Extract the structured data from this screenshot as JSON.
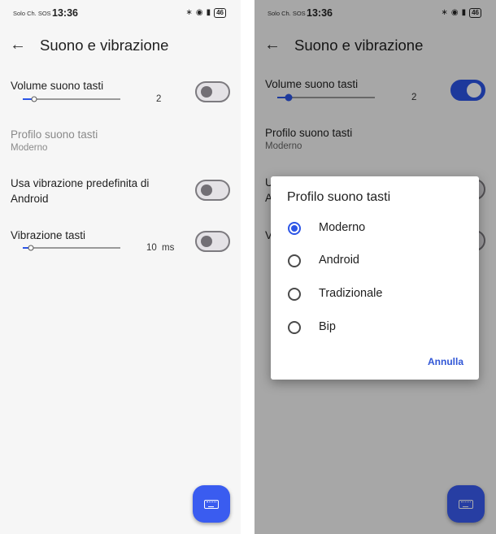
{
  "status_bar": {
    "carrier": "Solo Ch. SOS",
    "time": "13:36",
    "battery": "46",
    "icons": [
      "bluetooth-icon",
      "wifi-icon",
      "vibrate-icon",
      "battery-icon"
    ]
  },
  "appbar": {
    "back_icon": "back-arrow-icon",
    "title": "Suono e vibrazione"
  },
  "settings": {
    "volume": {
      "title": "Volume suono tasti",
      "value": "2",
      "level": 0.12
    },
    "profile": {
      "title": "Profilo suono tasti",
      "value": "Moderno"
    },
    "android_vibration": {
      "title": "Usa vibrazione predefinita di Android"
    },
    "key_vibration": {
      "title": "Vibrazione tasti",
      "value": "10",
      "unit": "ms",
      "level": 0.08
    }
  },
  "left_state": {
    "volume_toggle_on": false,
    "android_vibration_on": false,
    "key_vibration_on": false
  },
  "right_state": {
    "volume_toggle_on": true
  },
  "right_partial": {
    "android_vibration_fragment_line1": "U",
    "android_vibration_fragment_line2": "A",
    "key_vibration_fragment": "V"
  },
  "dialog": {
    "title": "Profilo suono tasti",
    "options": [
      {
        "label": "Moderno",
        "selected": true
      },
      {
        "label": "Android",
        "selected": false
      },
      {
        "label": "Tradizionale",
        "selected": false
      },
      {
        "label": "Bip",
        "selected": false
      }
    ],
    "cancel_label": "Annulla"
  },
  "fab": {
    "icon": "keyboard-icon"
  },
  "colors": {
    "accent": "#2c55e6",
    "fab": "#3a5cf0",
    "background": "#f6f6f6"
  }
}
